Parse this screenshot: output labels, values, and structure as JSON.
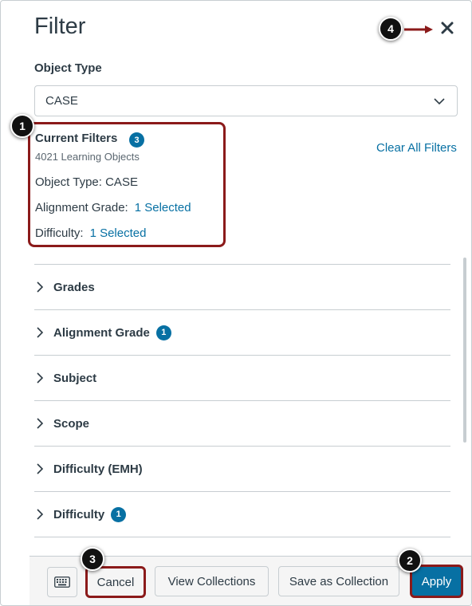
{
  "dialog": {
    "title": "Filter"
  },
  "object_type": {
    "label": "Object Type",
    "selected_value": "CASE"
  },
  "current_filters": {
    "title": "Current Filters",
    "count_badge": "3",
    "results_count": "4021 Learning Objects",
    "lines": [
      {
        "label": "Object Type: CASE",
        "link": ""
      },
      {
        "label": "Alignment Grade:",
        "link": "1 Selected"
      },
      {
        "label": "Difficulty:",
        "link": "1 Selected"
      }
    ],
    "clear_all_label": "Clear All Filters"
  },
  "filter_sections": [
    {
      "label": "Grades",
      "badge": ""
    },
    {
      "label": "Alignment Grade",
      "badge": "1"
    },
    {
      "label": "Subject",
      "badge": ""
    },
    {
      "label": "Scope",
      "badge": ""
    },
    {
      "label": "Difficulty (EMH)",
      "badge": ""
    },
    {
      "label": "Difficulty",
      "badge": "1"
    }
  ],
  "footer": {
    "cancel_label": "Cancel",
    "view_collections_label": "View Collections",
    "save_collection_label": "Save as Collection",
    "apply_label": "Apply"
  },
  "callouts": [
    "1",
    "2",
    "3",
    "4"
  ],
  "icons": {
    "close": "close-icon",
    "dropdown": "chevron-down-icon",
    "expand": "chevron-right-icon",
    "keyboard": "keyboard-icon"
  },
  "colors": {
    "accent": "#0770a3",
    "callout_outline": "#8b1a1a",
    "text": "#2d3b45"
  }
}
